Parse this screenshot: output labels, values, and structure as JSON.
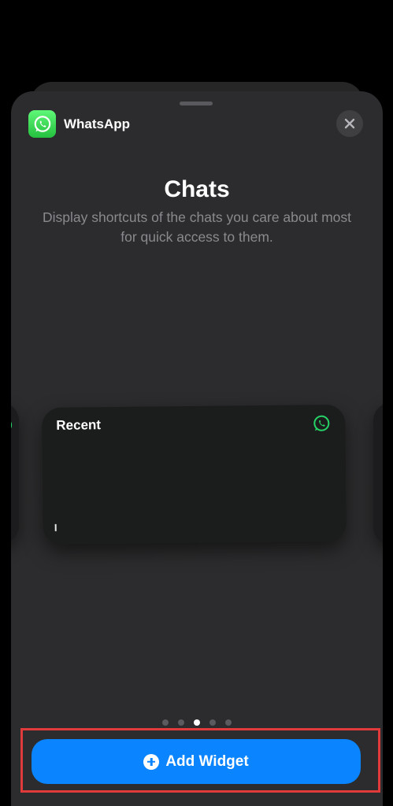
{
  "sheet": {
    "app_name": "WhatsApp",
    "app_icon": "whatsapp-icon",
    "close_icon": "close-icon"
  },
  "widget_info": {
    "title": "Chats",
    "description": "Display shortcuts of the chats you care about most for quick access to them."
  },
  "carousel": {
    "current_widget": {
      "label": "Recent",
      "icon": "whatsapp-icon"
    },
    "page_count": 5,
    "active_page": 3
  },
  "actions": {
    "add_widget_label": "Add Widget",
    "add_icon": "plus-circle-icon"
  },
  "colors": {
    "accent": "#0a84ff",
    "whatsapp_green": "#25d366",
    "highlight": "#e03a3a"
  }
}
